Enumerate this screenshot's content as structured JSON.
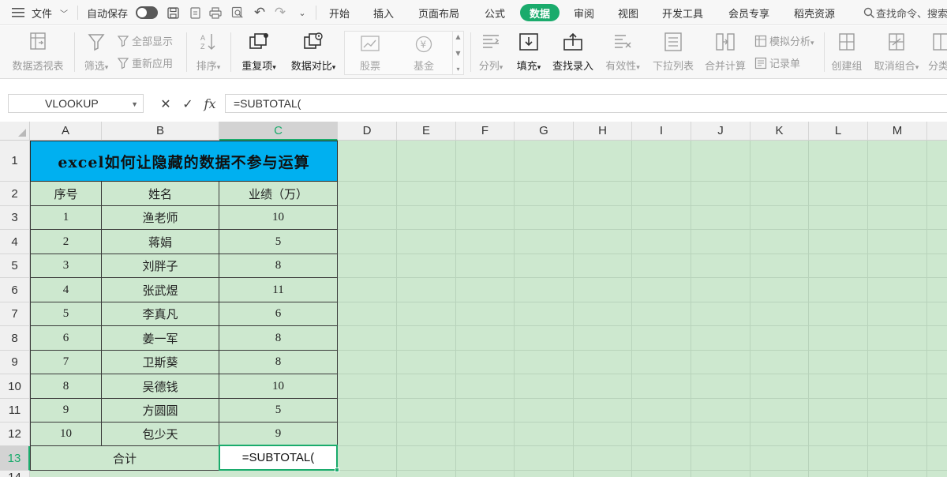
{
  "menubar": {
    "file": "文件",
    "autosave": "自动保存",
    "tabs": [
      "开始",
      "插入",
      "页面布局",
      "公式",
      "数据",
      "审阅",
      "视图",
      "开发工具",
      "会员专享",
      "稻壳资源"
    ],
    "active_tab": "数据",
    "search": "查找命令、搜索"
  },
  "ribbon": {
    "pivot": "数据透视表",
    "filter": "筛选",
    "show_all": "全部显示",
    "reapply": "重新应用",
    "sort": "排序",
    "duplicates": "重复项",
    "compare": "数据对比",
    "stock": "股票",
    "fund": "基金",
    "split": "分列",
    "fill": "填充",
    "lookup_entry": "查找录入",
    "validity": "有效性",
    "dropdown_list": "下拉列表",
    "consolidate": "合并计算",
    "whatif": "模拟分析",
    "record_form": "记录单",
    "group": "创建组",
    "ungroup": "取消组合",
    "subtotal_short": "分类"
  },
  "formula_bar": {
    "name_box": "VLOOKUP",
    "cancel": "✕",
    "confirm": "✓",
    "fx": "fx",
    "formula": "=SUBTOTAL("
  },
  "sheet": {
    "columns": [
      "A",
      "B",
      "C",
      "D",
      "E",
      "F",
      "G",
      "H",
      "I",
      "J",
      "K",
      "L",
      "M"
    ],
    "selected_column": "C",
    "rows": [
      "1",
      "2",
      "3",
      "4",
      "5",
      "6",
      "7",
      "8",
      "9",
      "10",
      "11",
      "12",
      "13",
      "14"
    ],
    "selected_row": "13",
    "title": "excel如何让隐藏的数据不参与运算",
    "headers": [
      "序号",
      "姓名",
      "业绩（万）"
    ],
    "data": [
      [
        "1",
        "渔老师",
        "10"
      ],
      [
        "2",
        "蒋娟",
        "5"
      ],
      [
        "3",
        "刘胖子",
        "8"
      ],
      [
        "4",
        "张武煜",
        "11"
      ],
      [
        "5",
        "李真凡",
        "6"
      ],
      [
        "6",
        "姜一军",
        "8"
      ],
      [
        "7",
        "卫斯葵",
        "8"
      ],
      [
        "8",
        "吴德钱",
        "10"
      ],
      [
        "9",
        "方圆圆",
        "5"
      ],
      [
        "10",
        "包少天",
        "9"
      ]
    ],
    "total_label": "合计",
    "active_cell_value": "=SUBTOTAL("
  },
  "colors": {
    "accent": "#1aab6c",
    "title_fill": "#00b0f0",
    "sheet_bg": "#cde8cf"
  }
}
